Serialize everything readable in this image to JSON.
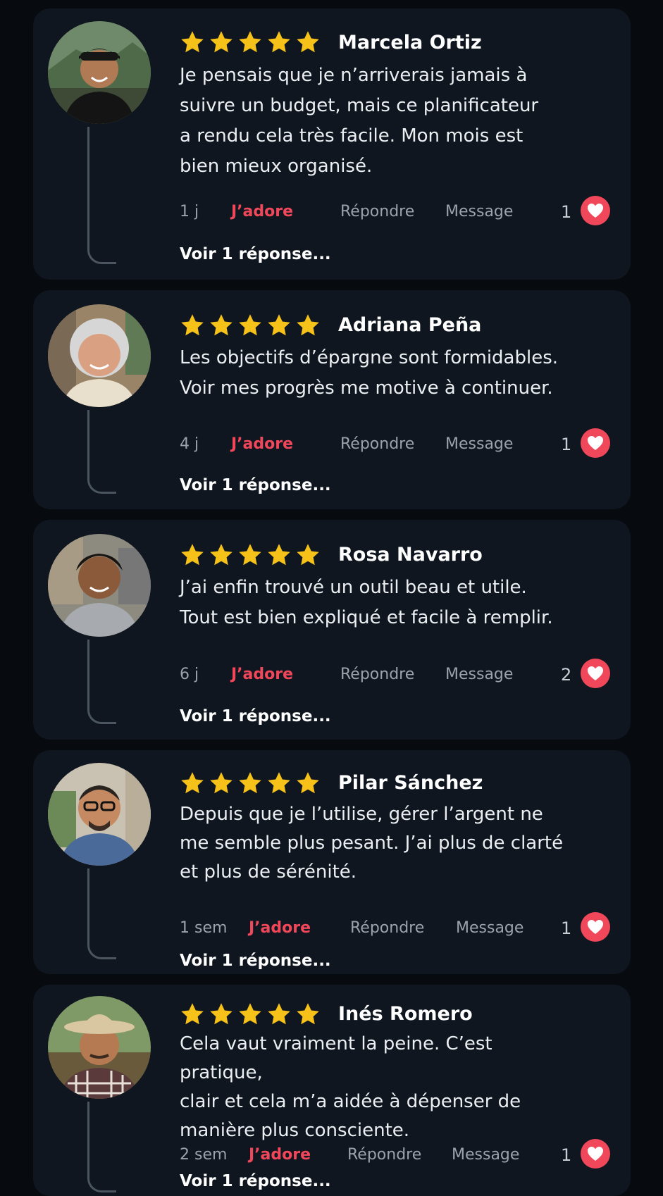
{
  "colors": {
    "accent": "#f0485a",
    "star": "#f6c21a",
    "card": "#0f161f",
    "background": "#070b10"
  },
  "reviews": [
    {
      "name": "Marcela Ortiz",
      "rating": 5,
      "text_lines": [
        "Je pensais que je n’arriverais jamais à",
        "suivre un budget, mais ce planificateur",
        "a rendu cela très facile. Mon mois est",
        "bien mieux organisé."
      ],
      "time": "1 j",
      "love_label": "J’adore",
      "reply_label": "Répondre",
      "message_label": "Message",
      "likes": "1",
      "replies_label": "Voir 1 réponse...",
      "heart_icon": "heart-icon"
    },
    {
      "name": "Adriana Peña",
      "rating": 5,
      "text_lines": [
        "Les objectifs d’épargne sont formidables.",
        "Voir mes progrès me motive à continuer."
      ],
      "time": "4 j",
      "love_label": "J’adore",
      "reply_label": "Répondre",
      "message_label": "Message",
      "likes": "1",
      "replies_label": "Voir 1 réponse...",
      "heart_icon": "heart-icon"
    },
    {
      "name": "Rosa Navarro",
      "rating": 5,
      "text_lines": [
        "J’ai enfin trouvé un outil beau et utile.",
        "Tout est bien expliqué et facile à remplir."
      ],
      "time": "6 j",
      "love_label": "J’adore",
      "reply_label": "Répondre",
      "message_label": "Message",
      "likes": "2",
      "replies_label": "Voir 1 réponse...",
      "heart_icon": "heart-icon"
    },
    {
      "name": "Pilar Sánchez",
      "rating": 5,
      "text_lines": [
        "Depuis que je l’utilise, gérer l’argent ne",
        "me semble plus pesant. J’ai plus de clarté",
        "et plus de sérénité."
      ],
      "time": "1 sem",
      "love_label": "J’adore",
      "reply_label": "Répondre",
      "message_label": "Message",
      "likes": "1",
      "replies_label": "Voir 1 réponse...",
      "heart_icon": "heart-icon"
    },
    {
      "name": "Inés Romero",
      "rating": 5,
      "text_lines": [
        "Cela vaut vraiment la peine. C’est pratique,",
        "clair et cela m’a aidée à dépenser de",
        "manière plus consciente."
      ],
      "time": "2 sem",
      "love_label": "J’adore",
      "reply_label": "Répondre",
      "message_label": "Message",
      "likes": "1",
      "replies_label": "Voir 1 réponse...",
      "heart_icon": "heart-icon"
    }
  ]
}
